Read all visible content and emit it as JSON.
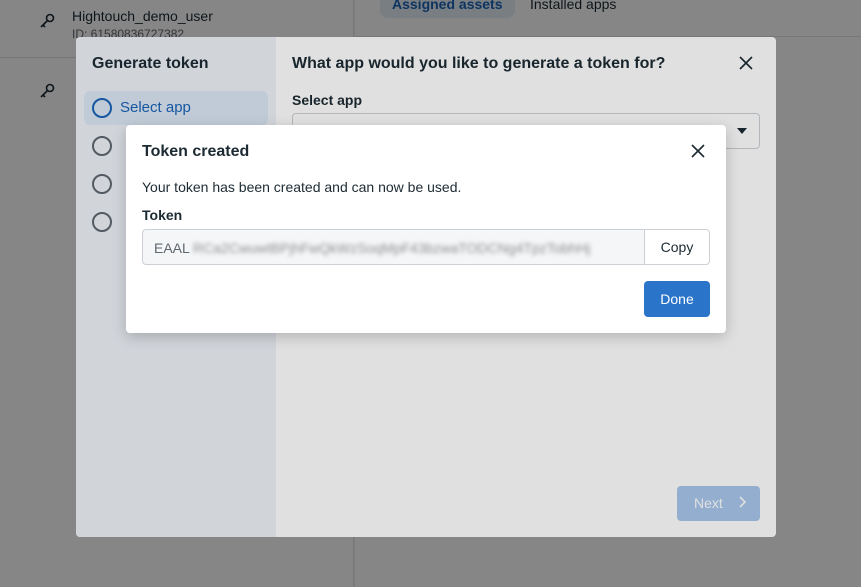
{
  "background": {
    "user": {
      "name": "Hightouch_demo_user",
      "id": "ID: 61580836727382"
    },
    "tabs": [
      "Assigned assets",
      "Installed apps"
    ]
  },
  "generate_dialog": {
    "title": "Generate token",
    "steps": [
      "Select app",
      "",
      "",
      ""
    ],
    "question": "What app would you like to generate a token for?",
    "select_label": "Select app",
    "next_label": "Next"
  },
  "modal": {
    "title": "Token created",
    "description": "Your token has been created and can now be used.",
    "token_label": "Token",
    "token_prefix": "EAAL",
    "token_hidden": "RCa2CwuwtBPjhFwQkWzSoqMpF43bzwaTODCNg4TpzTobhHj",
    "copy_label": "Copy",
    "done_label": "Done"
  },
  "colors": {
    "primary": "#2a74c9",
    "primary_disabled": "#a8c7ec",
    "active_step": "#1a64b7"
  }
}
